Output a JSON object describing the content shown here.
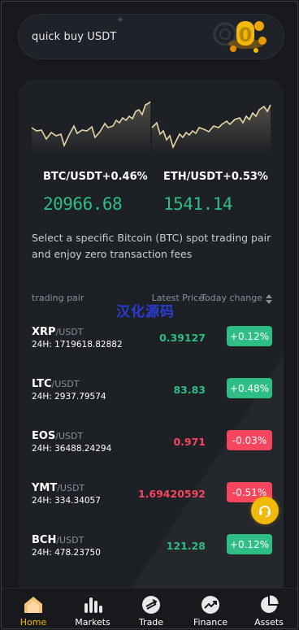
{
  "quick_buy": {
    "label": "quick buy USDT",
    "plus_glyph": "+",
    "art_glyph": "0"
  },
  "markets_card": {
    "pairs": [
      {
        "symbol": "BTC/USDT",
        "change": "+0.46%",
        "price": "20966.68"
      },
      {
        "symbol": "ETH/USDT",
        "change": "+0.53%",
        "price": "1541.14"
      }
    ],
    "description": "Select a specific Bitcoin (BTC) spot trading pair and enjoy zero transaction fees",
    "list_header": {
      "pair": "trading pair",
      "price": "Latest Price",
      "change": "Today change"
    },
    "watermark": "汉化源码",
    "rows": [
      {
        "base": "XRP",
        "quote": "/USDT",
        "volume": "24H: 1719618.82882",
        "price": "0.39127",
        "change": "+0.12%",
        "direction": "up"
      },
      {
        "base": "LTC",
        "quote": "/USDT",
        "volume": "24H: 2937.79574",
        "price": "83.83",
        "change": "+0.48%",
        "direction": "up"
      },
      {
        "base": "EOS",
        "quote": "/USDT",
        "volume": "24H: 36488.24294",
        "price": "0.971",
        "change": "-0.03%",
        "direction": "down"
      },
      {
        "base": "YMT",
        "quote": "/USDT",
        "volume": "24H: 334.34057",
        "price": "1.69420592",
        "change": "-0.51%",
        "direction": "down"
      },
      {
        "base": "BCH",
        "quote": "/USDT",
        "volume": "24H: 478.23750",
        "price": "121.28",
        "change": "+0.12%",
        "direction": "up"
      }
    ]
  },
  "tabbar": {
    "tabs": [
      {
        "label": "Home",
        "icon": "home-icon",
        "active": true
      },
      {
        "label": "Markets",
        "icon": "bar-chart-icon",
        "active": false
      },
      {
        "label": "Trade",
        "icon": "trade-swap-icon",
        "active": false
      },
      {
        "label": "Finance",
        "icon": "finance-trend-icon",
        "active": false
      },
      {
        "label": "Assets",
        "icon": "pie-chart-icon",
        "active": false
      }
    ]
  },
  "colors": {
    "background": "#17191d",
    "card": "#1d2025",
    "up": "#2ebd85",
    "down": "#f6465d",
    "accent": "#f0b90b",
    "sparkline": "#e8d5a6",
    "watermark": "#2a3cd8"
  }
}
